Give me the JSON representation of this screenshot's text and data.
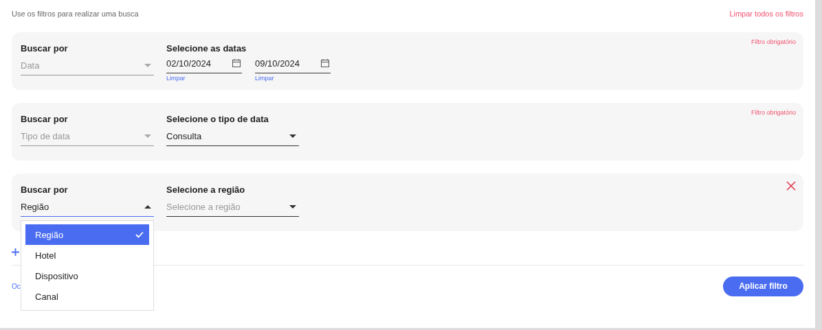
{
  "hint": "Use os filtros para realizar uma busca",
  "clear_all": "Limpar todos os filtros",
  "filters": [
    {
      "kind": "dates",
      "search_label": "Buscar por",
      "search_value": "Data",
      "open": false,
      "field_label": "Selecione as datas",
      "required": "Filtro obrigatório",
      "dates": [
        {
          "value": "02/10/2024",
          "clear": "Limpar"
        },
        {
          "value": "09/10/2024",
          "clear": "Limpar"
        }
      ]
    },
    {
      "kind": "select",
      "search_label": "Buscar por",
      "search_value": "Tipo de data",
      "open": false,
      "field_label": "Selecione o tipo de data",
      "required": "Filtro obrigatório",
      "value": "Consulta"
    },
    {
      "kind": "select",
      "search_label": "Buscar por",
      "search_value": "Região",
      "open": true,
      "removable": true,
      "field_label": "Selecione a região",
      "placeholder": "Selecione a região",
      "options": [
        {
          "label": "Região",
          "selected": true
        },
        {
          "label": "Hotel",
          "selected": false
        },
        {
          "label": "Dispositivo",
          "selected": false
        },
        {
          "label": "Canal",
          "selected": false
        }
      ]
    }
  ],
  "footer_link": "Oc",
  "apply": "Aplicar filtro"
}
